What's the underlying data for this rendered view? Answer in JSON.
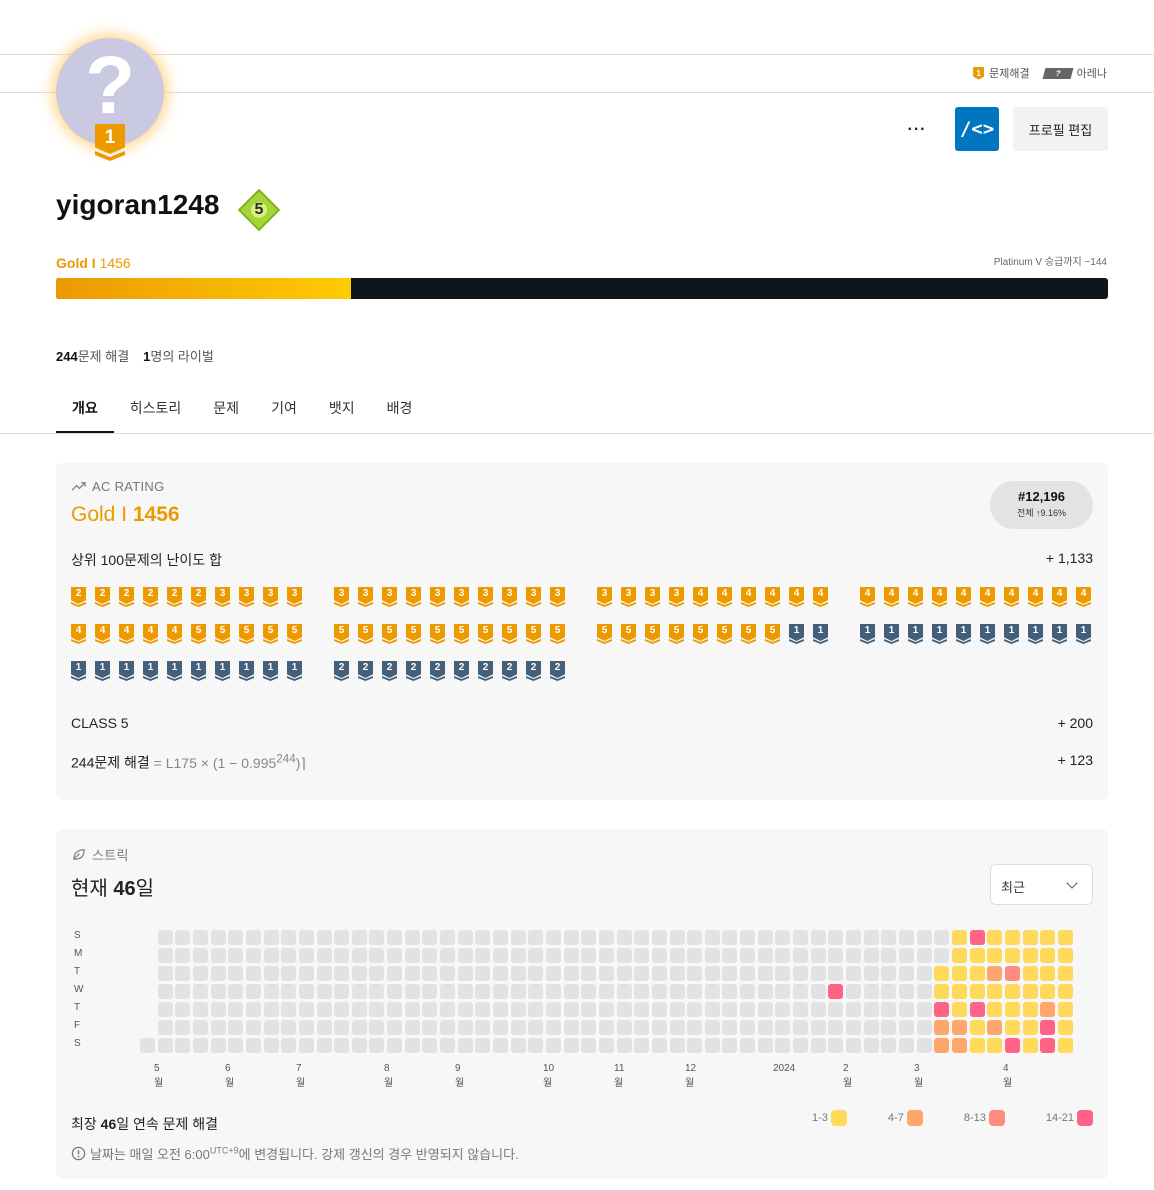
{
  "subnav": {
    "solve_label": "문제해결",
    "solve_tier": "1",
    "arena_label": "아레나",
    "arena_tier": "?"
  },
  "avatar": {
    "glyph": "?",
    "tier": "1",
    "tier_color": "#ec9a00"
  },
  "actions": {
    "more": "···",
    "code": "/<>",
    "edit": "프로필 편집"
  },
  "profile": {
    "username": "yigoran1248",
    "class": "5",
    "tier_name": "Gold I",
    "rating": "1456",
    "next_tier": "Platinum V 승급까지 −144",
    "progress_fraction": 0.28,
    "solved_count": "244",
    "solved_label": "문제 해결",
    "rival_count": "1",
    "rival_label": "명의 라이벌"
  },
  "tabs": [
    "개요",
    "히스토리",
    "문제",
    "기여",
    "뱃지",
    "배경"
  ],
  "ac_rating": {
    "header": "AC RATING",
    "tier_name": "Gold I",
    "rating": "1456",
    "rank": "#12,196",
    "rank_sub": "전체 ↑9.16%",
    "top100_label": "상위 100문제의 난이도 합",
    "top100_value": "+ 1,133",
    "class_label": "CLASS 5",
    "class_value": "+ 200",
    "solved_formula": "244문제 해결",
    "formula_rest": " = L175 × (1 − 0.995",
    "formula_exp": "244",
    "formula_end": ")⌉",
    "solved_value": "+ 123",
    "tier_rows": [
      [
        "2",
        "2",
        "2",
        "2",
        "2",
        "2",
        "3",
        "3",
        "3",
        "3",
        "3",
        "3",
        "3",
        "3",
        "3",
        "3",
        "3",
        "3",
        "3",
        "3",
        "3",
        "3",
        "3",
        "3",
        "4",
        "4",
        "4",
        "4",
        "4",
        "4",
        "4",
        "4",
        "4",
        "4",
        "4",
        "4",
        "4",
        "4",
        "4",
        "4"
      ],
      [
        "4",
        "4",
        "4",
        "4",
        "4",
        "5",
        "5",
        "5",
        "5",
        "5",
        "5",
        "5",
        "5",
        "5",
        "5",
        "5",
        "5",
        "5",
        "5",
        "5",
        "5",
        "5",
        "5",
        "5",
        "5",
        "5",
        "5",
        "5",
        "1",
        "1",
        "1",
        "1",
        "1",
        "1",
        "1",
        "1",
        "1",
        "1",
        "1",
        "1"
      ],
      [
        "1",
        "1",
        "1",
        "1",
        "1",
        "1",
        "1",
        "1",
        "1",
        "1",
        "2",
        "2",
        "2",
        "2",
        "2",
        "2",
        "2",
        "2",
        "2",
        "2"
      ]
    ],
    "tier_kinds": [
      [
        "g",
        "g",
        "g",
        "g",
        "g",
        "g",
        "g",
        "g",
        "g",
        "g",
        "g",
        "g",
        "g",
        "g",
        "g",
        "g",
        "g",
        "g",
        "g",
        "g",
        "g",
        "g",
        "g",
        "g",
        "g",
        "g",
        "g",
        "g",
        "g",
        "g",
        "g",
        "g",
        "g",
        "g",
        "g",
        "g",
        "g",
        "g",
        "g",
        "g"
      ],
      [
        "g",
        "g",
        "g",
        "g",
        "g",
        "g",
        "g",
        "g",
        "g",
        "g",
        "g",
        "g",
        "g",
        "g",
        "g",
        "g",
        "g",
        "g",
        "g",
        "g",
        "g",
        "g",
        "g",
        "g",
        "g",
        "g",
        "g",
        "g",
        "s",
        "s",
        "s",
        "s",
        "s",
        "s",
        "s",
        "s",
        "s",
        "s",
        "s",
        "s"
      ],
      [
        "s",
        "s",
        "s",
        "s",
        "s",
        "s",
        "s",
        "s",
        "s",
        "s",
        "s",
        "s",
        "s",
        "s",
        "s",
        "s",
        "s",
        "s",
        "s",
        "s"
      ]
    ]
  },
  "streak": {
    "header": "스트릭",
    "current_prefix": "현재 ",
    "current_days": "46",
    "current_suffix": "일",
    "select_value": "최근",
    "days": [
      "S",
      "M",
      "T",
      "W",
      "T",
      "F",
      "S"
    ],
    "months": [
      "5월",
      "6월",
      "7월",
      "8월",
      "9월",
      "10월",
      "11월",
      "12월",
      "2024",
      "2월",
      "3월",
      "4월"
    ],
    "longest_prefix": "최장 ",
    "longest_days": "46",
    "longest_suffix": "일 연속 문제 해결",
    "note_prefix": "날짜는 매일 오전 6:00",
    "note_sup": "UTC+9",
    "note_suffix": "에 변경됩니다. 강제 갱신의 경우 반영되지 않습니다.",
    "legend": [
      {
        "label": "1-3",
        "color": "#ffd95a"
      },
      {
        "label": "4-7",
        "color": "#ffa66b"
      },
      {
        "label": "8-13",
        "color": "#ff8a82"
      },
      {
        "label": "14-21",
        "color": "#ff6385"
      }
    ],
    "empty_color": "#e2e2e4",
    "active_weeks": [
      [
        "3",
        "3",
        "4",
        "3",
        "3",
        "3",
        "3",
        "3"
      ],
      [
        "3",
        "3",
        "3",
        "3",
        "3",
        "3",
        "3",
        "3"
      ],
      [
        "3",
        "3",
        "3",
        "2",
        "1",
        "3",
        "3",
        "3"
      ],
      [
        "3",
        "3",
        "3",
        "3",
        "3",
        "3",
        "3",
        "3"
      ],
      [
        "4",
        "3",
        "4",
        "3",
        "3",
        "3",
        "2",
        "3"
      ],
      [
        "2",
        "2",
        "3",
        "2",
        "3",
        "3",
        "4",
        "3"
      ],
      [
        "2",
        "2",
        "3",
        "3",
        "4",
        "3",
        "4",
        "3"
      ]
    ],
    "extra_active": [
      {
        "week": 39,
        "day": 3,
        "level": "4"
      }
    ]
  }
}
